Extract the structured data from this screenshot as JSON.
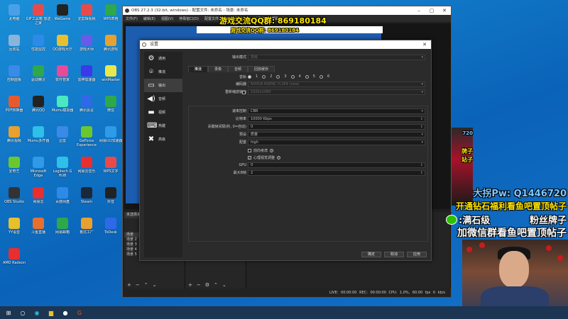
{
  "desktop_icons": [
    {
      "label": "此电脑",
      "color": "#4aa0e8"
    },
    {
      "label": "GIF工具箱 放送之家",
      "color": "#e84a4a"
    },
    {
      "label": "WeGame",
      "color": "#222222"
    },
    {
      "label": "爱剪辑视频",
      "color": "#e84a4a"
    },
    {
      "label": "WPS表格",
      "color": "#2ea84a"
    },
    {
      "label": "回收站",
      "color": "#8ab4d8"
    },
    {
      "label": "性能监控",
      "color": "#2e8ae8"
    },
    {
      "label": "QQ游戏大厅",
      "color": "#e8c02e"
    },
    {
      "label": "游戏大师",
      "color": "#6a5ae8"
    },
    {
      "label": "腾讯游戏",
      "color": "#e8a02e"
    },
    {
      "label": "控制面板",
      "color": "#3a8ae8"
    },
    {
      "label": "驱动精灵",
      "color": "#2ea84a"
    },
    {
      "label": "软件管家",
      "color": "#e84a9a"
    },
    {
      "label": "雷神加速器",
      "color": "#3a3ae8"
    },
    {
      "label": "winMaster",
      "color": "#e8e84a"
    },
    {
      "label": "PDF转换器",
      "color": "#e85a2e"
    },
    {
      "label": "腾讯QQ",
      "color": "#222222"
    },
    {
      "label": "Mumu模拟器",
      "color": "#4ae8c0"
    },
    {
      "label": "腾讯会议",
      "color": "#2e6ae8"
    },
    {
      "label": "微信",
      "color": "#2ea84a"
    },
    {
      "label": "腾讯视频",
      "color": "#e8a02e"
    },
    {
      "label": "Mumu多开器",
      "color": "#2ec0e8"
    },
    {
      "label": "迅雷",
      "color": "#3a8ae8"
    },
    {
      "label": "GeForce Experience",
      "color": "#6ac82e"
    },
    {
      "label": "网易UU加速器",
      "color": "#2e9ae8"
    },
    {
      "label": "爱奇艺",
      "color": "#6ac82e"
    },
    {
      "label": "Microsoft Edge",
      "color": "#2e9ae8"
    },
    {
      "label": "Logitech G HUB",
      "color": "#2ec0e8"
    },
    {
      "label": "网易云音乐",
      "color": "#e82e2e"
    },
    {
      "label": "WPS文字",
      "color": "#e84a4a"
    },
    {
      "label": "OBS Studio",
      "color": "#333333"
    },
    {
      "label": "网易云",
      "color": "#e82e2e"
    },
    {
      "label": "百度网盘",
      "color": "#2e8ae8"
    },
    {
      "label": "Steam",
      "color": "#1b2838"
    },
    {
      "label": "抖音",
      "color": "#222222"
    },
    {
      "label": "YY语音",
      "color": "#e8c02e"
    },
    {
      "label": "斗鱼直播",
      "color": "#e8702e"
    },
    {
      "label": "网易邮箱",
      "color": "#2ea84a"
    },
    {
      "label": "格式工厂",
      "color": "#e8a02e"
    },
    {
      "label": "ToDesk",
      "color": "#2e6ae8"
    },
    {
      "label": "AMD Radeon",
      "color": "#e82e2e"
    }
  ],
  "obs": {
    "title": "OBS 27.2.3 (32-bit, windows) - 配置文件: 未命名 - 场景: 未命名",
    "menu": [
      "文件(F)",
      "编辑(E)",
      "视图(V)",
      "停靠窗口(D)",
      "配置文件(P)",
      "场景集合(S)",
      "工具(T)",
      "帮助(H)"
    ],
    "scenes_header": "来源",
    "sources_label": "未选择来源",
    "scenes": [
      "场景",
      "场景 2",
      "场景 3",
      "场景 4",
      "场景 5"
    ],
    "status": "LIVE: 00:00:00   REC: 00:00:00   CPU: 1.0%, 60.00 fps   0 kb/s"
  },
  "overlays": {
    "qq_group": "游戏交流QQ群: 869180184",
    "qq_group_small": "游戏交流QQ群: 869180184",
    "side_num": "720",
    "side_text": "牌子",
    "side_text2": "站子"
  },
  "settings": {
    "title": "设置",
    "sidebar": [
      {
        "label": "通用",
        "icon": "⚙"
      },
      {
        "label": "推流",
        "icon": "📡"
      },
      {
        "label": "输出",
        "icon": "▭"
      },
      {
        "label": "音频",
        "icon": "🔊"
      },
      {
        "label": "视频",
        "icon": "🖥"
      },
      {
        "label": "热键",
        "icon": "⌨"
      },
      {
        "label": "高级",
        "icon": "✖"
      }
    ],
    "output_mode_label": "输出模式",
    "output_mode_value": "高级",
    "tabs": [
      "推流",
      "录像",
      "音频",
      "回放缓存"
    ],
    "track_label": "音轨",
    "tracks": [
      "1",
      "2",
      "3",
      "4",
      "5",
      "6"
    ],
    "encoder_label": "编码器",
    "encoder_value": "NVIDIA NVENC H.264 (new)",
    "rescale_label": "重新缩放输出",
    "rescale_value": "1920x1080",
    "rate_control_label": "速率控制",
    "rate_control_value": "CBR",
    "bitrate_label": "比特率",
    "bitrate_value": "10000 Kbps",
    "keyframe_label": "关键帧间隔(秒, 0=自动)",
    "keyframe_value": "0",
    "preset_label": "预设",
    "preset_value": "质量",
    "profile_label": "配置",
    "profile_value": "high",
    "lookahead_label": "前向考虑",
    "psycho_label": "心理视觉调整",
    "gpu_label": "GPU",
    "gpu_value": "0",
    "bframes_label": "最大B帧",
    "bframes_value": "2",
    "ok": "确定",
    "cancel": "取消",
    "apply": "应用"
  },
  "promo": {
    "line1": "大拐Pw: Q1446720",
    "line2": "开通钻石福利看鱼吧置顶帖子",
    "line3": ":满石级",
    "line3b": "粉丝牌子",
    "line4": "加微信群看鱼吧置顶帖子"
  },
  "colors": {
    "qq_yellow": "#ffe600",
    "promo_blue": "#7ec8ff",
    "promo_yellow": "#ffe600",
    "promo_white": "#ffffff",
    "wechat_green": "#2dc100"
  },
  "taskbar": [
    "start-icon",
    "search-icon",
    "edge-icon",
    "explorer-icon",
    "obs-icon",
    "logitech-icon"
  ]
}
